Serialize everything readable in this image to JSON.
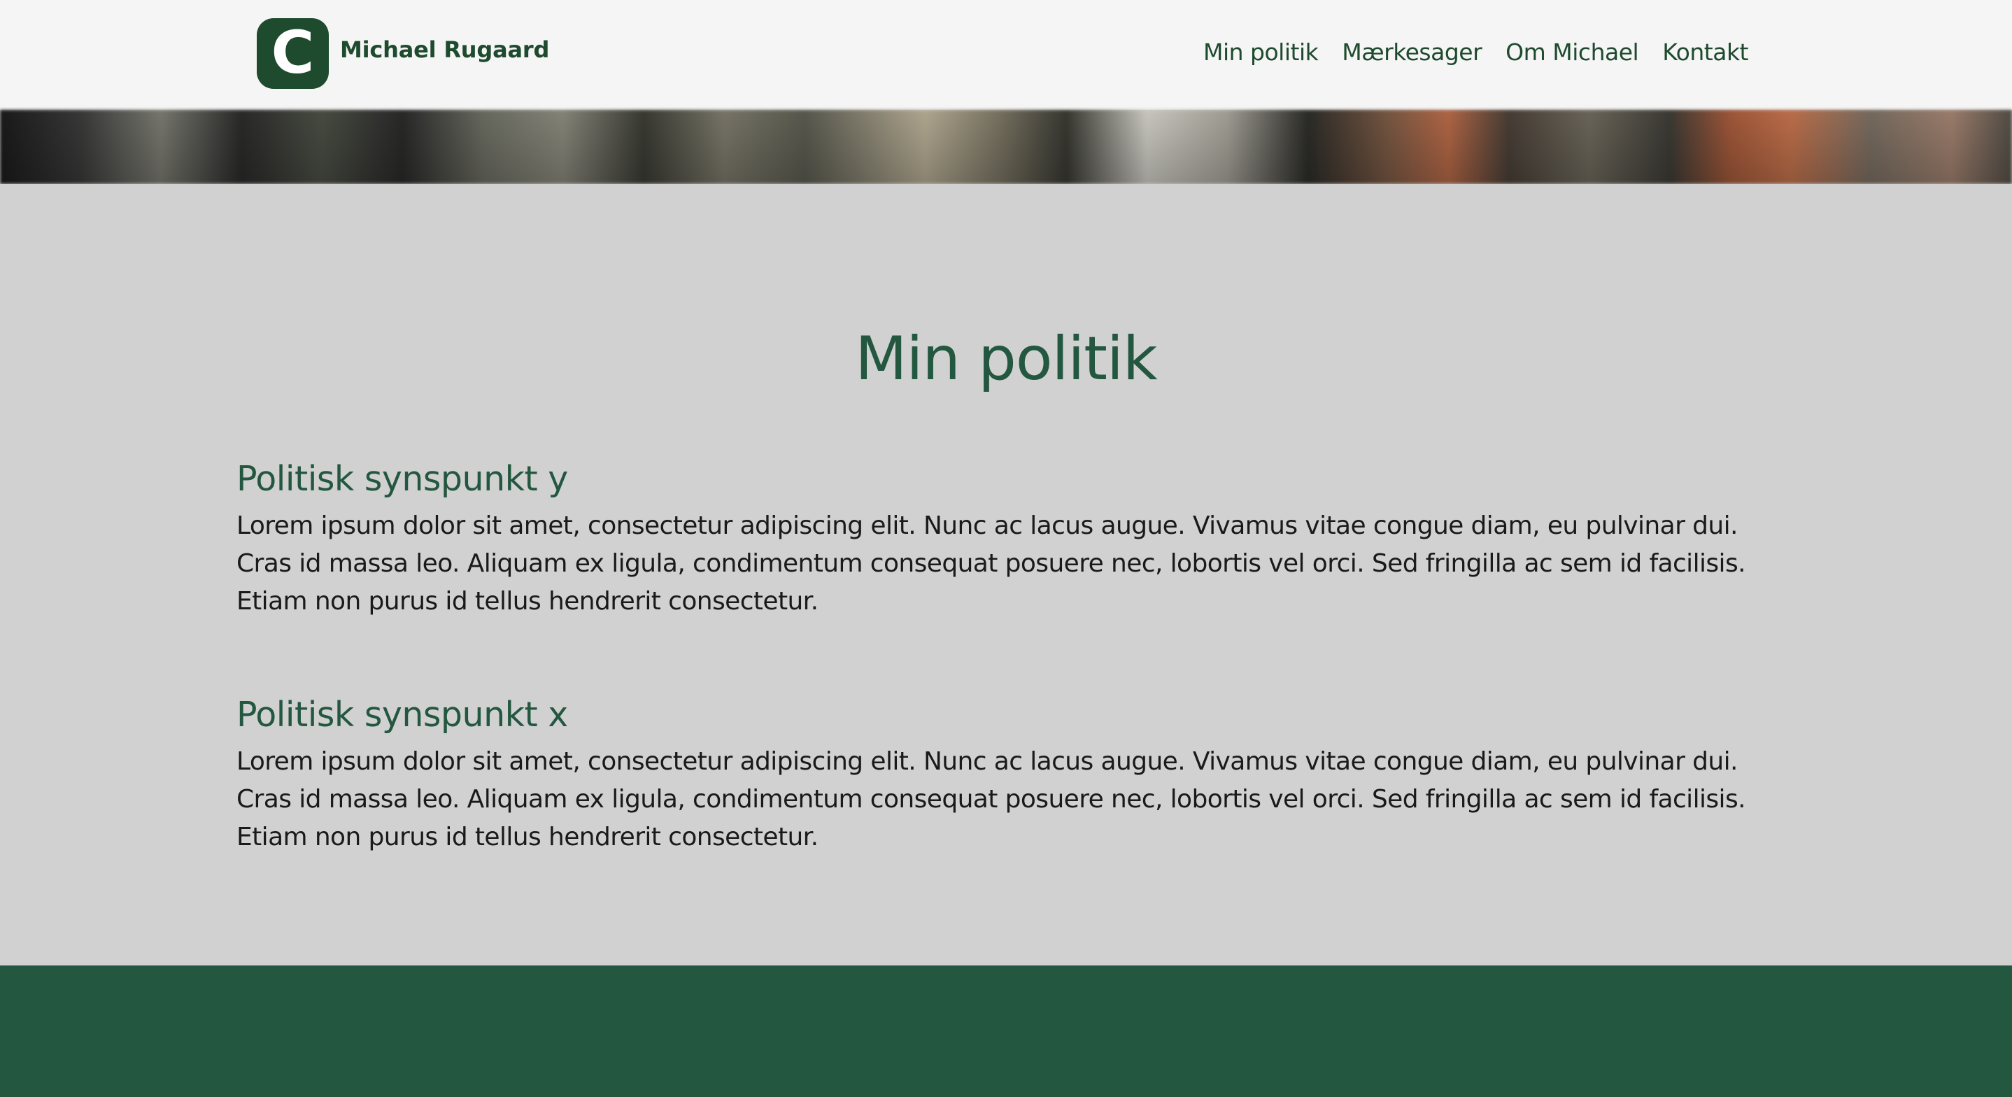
{
  "brand": {
    "logo_letter": "C",
    "name": "Michael Rugaard"
  },
  "nav": {
    "items": [
      {
        "label": "Min politik"
      },
      {
        "label": "Mærkesager"
      },
      {
        "label": "Om Michael"
      },
      {
        "label": "Kontakt"
      }
    ]
  },
  "main": {
    "title": "Min politik",
    "sections": [
      {
        "heading": "Politisk synspunkt y",
        "body": "Lorem ipsum dolor sit amet, consectetur adipiscing elit. Nunc ac lacus augue. Vivamus vitae congue diam, eu pulvinar dui. Cras id massa leo. Aliquam ex ligula, condimentum consequat posuere nec, lobortis vel orci. Sed fringilla ac sem id facilisis. Etiam non purus id tellus hendrerit consectetur."
      },
      {
        "heading": "Politisk synspunkt x",
        "body": "Lorem ipsum dolor sit amet, consectetur adipiscing elit. Nunc ac lacus augue. Vivamus vitae congue diam, eu pulvinar dui. Cras id massa leo. Aliquam ex ligula, condimentum consequat posuere nec, lobortis vel orci. Sed fringilla ac sem id facilisis. Etiam non purus id tellus hendrerit consectetur."
      }
    ]
  },
  "colors": {
    "brand_green": "#235740",
    "logo_green": "#1e4a2e",
    "header_bg": "#f5f5f5",
    "main_bg": "#d1d1d1",
    "footer_bg": "#235740"
  }
}
